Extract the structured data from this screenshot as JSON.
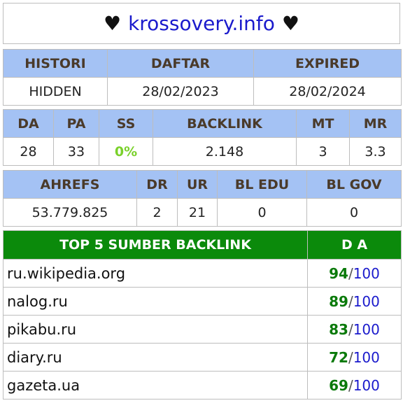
{
  "header": {
    "heart_left": "♥",
    "site": "krossovery.info",
    "heart_right": "♥"
  },
  "dates": {
    "headers": [
      "HISTORI",
      "DAFTAR",
      "EXPIRED"
    ],
    "values": [
      "HIDDEN",
      "28/02/2023",
      "28/02/2024"
    ]
  },
  "metrics": {
    "headers": [
      "DA",
      "PA",
      "SS",
      "BACKLINK",
      "MT",
      "MR"
    ],
    "values": [
      "28",
      "33",
      "0%",
      "2.148",
      "3",
      "3.3"
    ]
  },
  "ahrefs": {
    "headers": [
      "AHREFS",
      "DR",
      "UR",
      "BL EDU",
      "BL GOV"
    ],
    "values": [
      "53.779.825",
      "2",
      "21",
      "0",
      "0"
    ]
  },
  "top_backlinks": {
    "headers": [
      "TOP 5 SUMBER BACKLINK",
      "D A"
    ],
    "max": "100",
    "sep": "/",
    "rows": [
      {
        "domain": "ru.wikipedia.org",
        "da": "94"
      },
      {
        "domain": "nalog.ru",
        "da": "89"
      },
      {
        "domain": "pikabu.ru",
        "da": "83"
      },
      {
        "domain": "diary.ru",
        "da": "72"
      },
      {
        "domain": "gazeta.ua",
        "da": "69"
      }
    ]
  },
  "colors": {
    "header_blue": "#a4c2f4",
    "header_green": "#0b8a0b",
    "link_blue": "#1a1acc",
    "ss_green": "#7ad12b"
  }
}
